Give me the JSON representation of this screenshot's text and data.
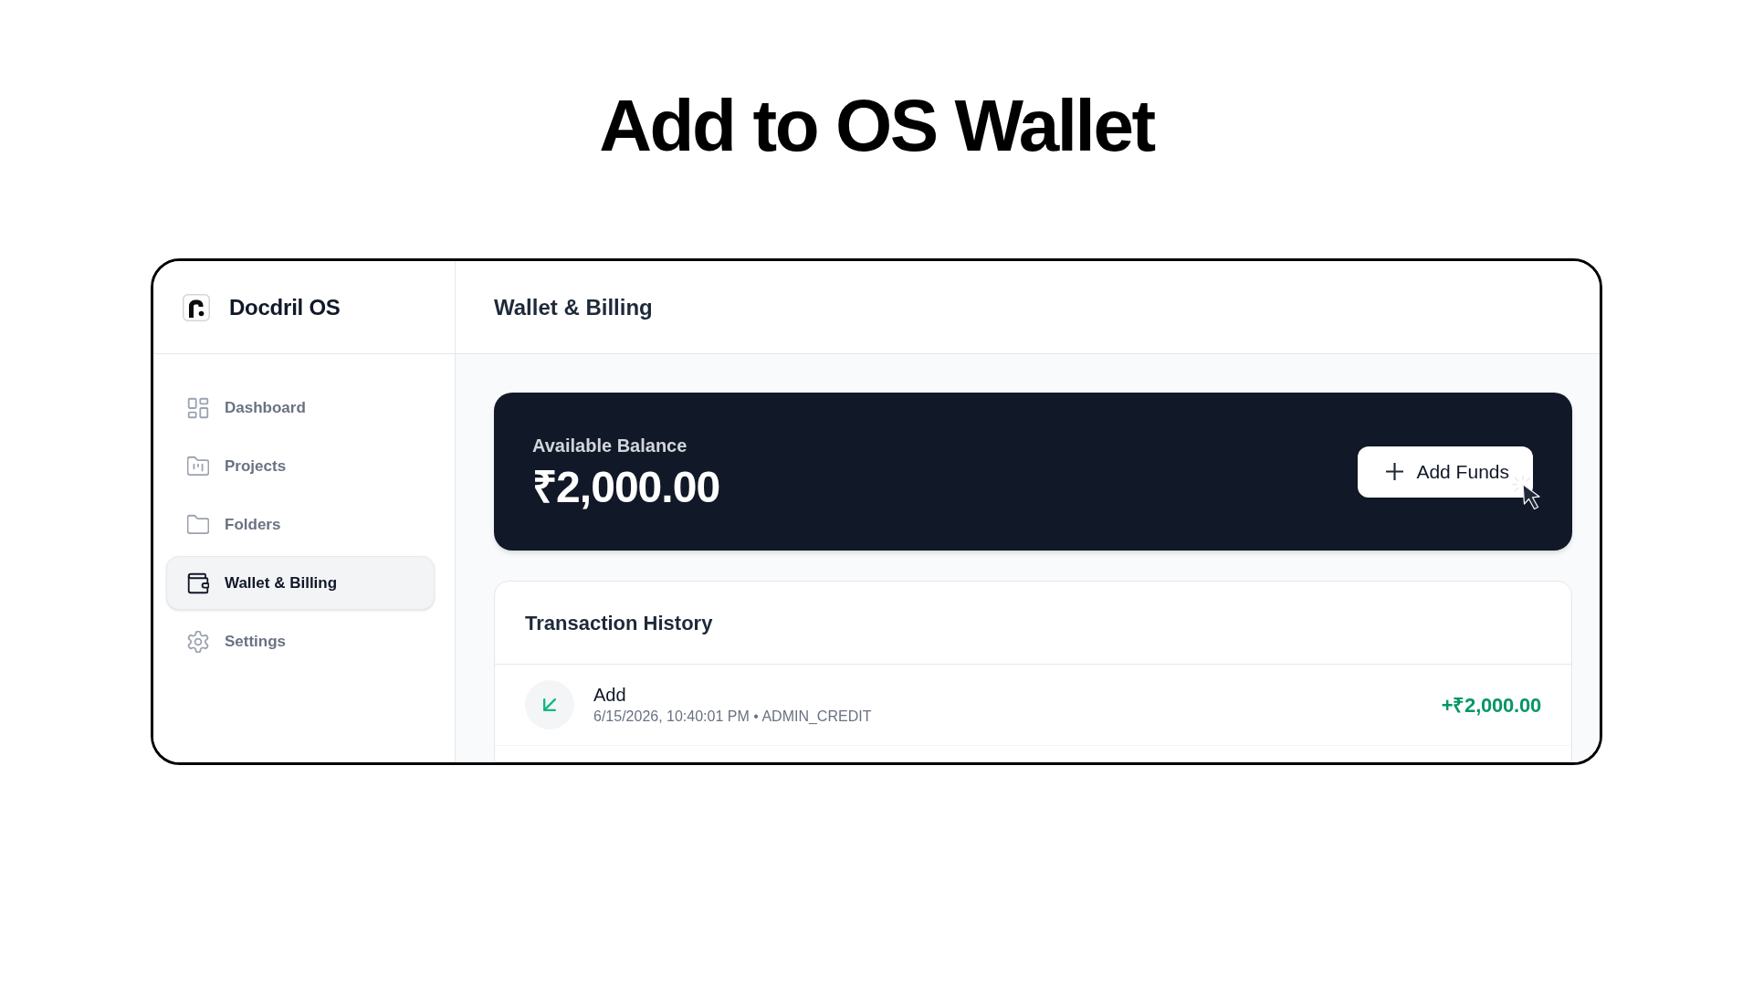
{
  "heading": "Add to OS Wallet",
  "app": {
    "brand": "Docdril OS",
    "sidebar": {
      "items": [
        {
          "label": "Dashboard",
          "selected": false
        },
        {
          "label": "Projects",
          "selected": false
        },
        {
          "label": "Folders",
          "selected": false
        },
        {
          "label": "Wallet & Billing",
          "selected": true
        },
        {
          "label": "Settings",
          "selected": false
        }
      ]
    },
    "page_title": "Wallet & Billing",
    "balance_card": {
      "label": "Available Balance",
      "amount": "₹2,000.00",
      "add_button": "Add Funds"
    },
    "transaction_history": {
      "title": "Transaction History",
      "rows": [
        {
          "title": "Add",
          "details": "6/15/2026, 10:40:01 PM • ADMIN_CREDIT",
          "amount": "+₹2,000.00"
        }
      ]
    }
  }
}
